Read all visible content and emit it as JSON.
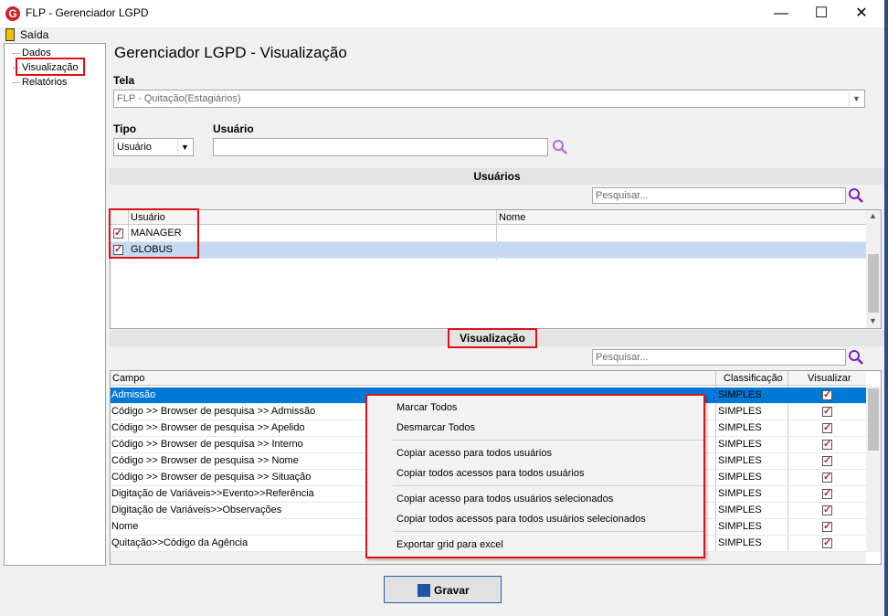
{
  "window": {
    "title": "FLP - Gerenciador LGPD",
    "minimize": "—",
    "maximize": "☐",
    "close": "✕"
  },
  "menu": {
    "exit_label": "Saída"
  },
  "tree": {
    "items": [
      "Dados",
      "Visualização",
      "Relatórios"
    ]
  },
  "page": {
    "heading": "Gerenciador LGPD - Visualização"
  },
  "tela": {
    "label": "Tela",
    "value": "FLP - Quitação(Estagiários)"
  },
  "tipo": {
    "label": "Tipo",
    "value": "Usuário"
  },
  "usuario": {
    "label": "Usuário",
    "value": ""
  },
  "users_section": {
    "title": "Usuários",
    "search_placeholder": "Pesquisar...",
    "columns": [
      "Usuário",
      "Nome"
    ],
    "rows": [
      {
        "checked": true,
        "user": "MANAGER",
        "name": ""
      },
      {
        "checked": true,
        "user": "GLOBUS",
        "name": ""
      }
    ]
  },
  "view_section": {
    "title": "Visualização",
    "search_placeholder": "Pesquisar...",
    "columns": [
      "Campo",
      "Classificação",
      "Visualizar"
    ],
    "rows": [
      {
        "campo": "Admissão",
        "classificacao": "SIMPLES",
        "visualizar": true
      },
      {
        "campo": "Código >> Browser de pesquisa >> Admissão",
        "classificacao": "SIMPLES",
        "visualizar": true
      },
      {
        "campo": "Código >> Browser de pesquisa >> Apelido",
        "classificacao": "SIMPLES",
        "visualizar": true
      },
      {
        "campo": "Código >> Browser de pesquisa >> Interno",
        "classificacao": "SIMPLES",
        "visualizar": true
      },
      {
        "campo": "Código >> Browser de pesquisa >> Nome",
        "classificacao": "SIMPLES",
        "visualizar": true
      },
      {
        "campo": "Código >> Browser de pesquisa >> Situação",
        "classificacao": "SIMPLES",
        "visualizar": true
      },
      {
        "campo": "Digitação de Variáveis>>Evento>>Referência",
        "classificacao": "SIMPLES",
        "visualizar": true
      },
      {
        "campo": "Digitação de Variáveis>>Observações",
        "classificacao": "SIMPLES",
        "visualizar": true
      },
      {
        "campo": "Nome",
        "classificacao": "SIMPLES",
        "visualizar": true
      },
      {
        "campo": "Quitação>>Código da Agência",
        "classificacao": "SIMPLES",
        "visualizar": true
      }
    ]
  },
  "context_menu": {
    "items": [
      "Marcar Todos",
      "Desmarcar Todos",
      "Copiar acesso para todos usuários",
      "Copiar todos acessos para todos usuários",
      "Copiar acesso para todos usuários selecionados",
      "Copiar todos acessos para todos usuários selecionados",
      "Exportar grid para excel"
    ]
  },
  "footer": {
    "save_label": "Gravar"
  },
  "colors": {
    "selection": "#0078d7",
    "row_highlight": "#c5d9f1",
    "annotation": "#e0101a",
    "search_icon": "#8a2be2"
  }
}
